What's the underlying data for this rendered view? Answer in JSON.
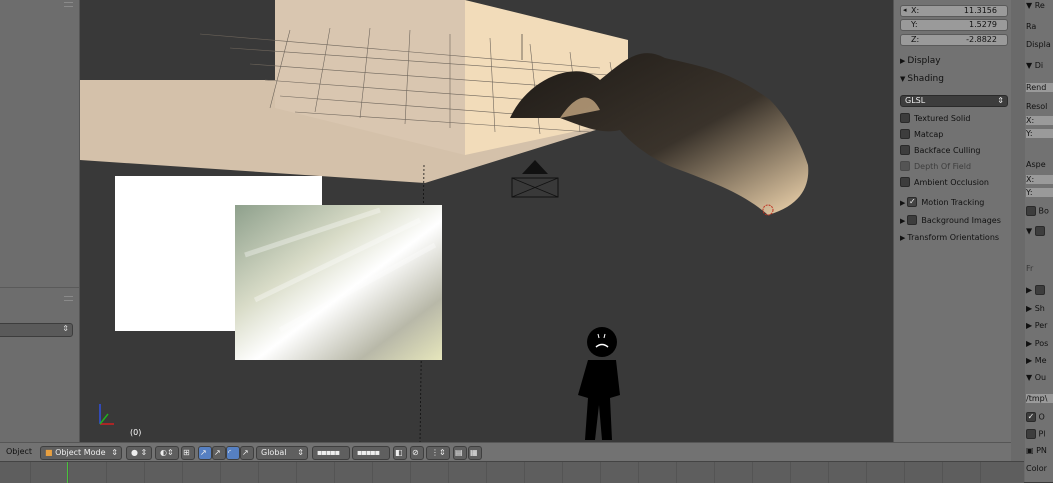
{
  "transform": {
    "x_label": "X:",
    "x_value": "11.3156",
    "y_label": "Y:",
    "y_value": "1.5279",
    "z_label": "Z:",
    "z_value": "-2.8822"
  },
  "panels": {
    "display": "Display",
    "shading": "Shading",
    "shading_mode": "GLSL",
    "textured_solid": "Textured Solid",
    "matcap": "Matcap",
    "backface_culling": "Backface Culling",
    "depth_of_field": "Depth Of Field",
    "ambient_occlusion": "Ambient Occlusion",
    "motion_tracking": "Motion Tracking",
    "background_images": "Background Images",
    "transform_orientations": "Transform Orientations"
  },
  "viewport": {
    "frame_label": "(0)"
  },
  "header": {
    "editor_menu": "Object",
    "mode": "Object Mode",
    "orientation": "Global"
  },
  "far_right": {
    "render_label": "Re",
    "render_btn": "Ra",
    "display_label": "Displa",
    "dimensions": "Di",
    "render_preset": "Rend",
    "resolution": "Resol",
    "res_x": "X:",
    "res_y": "Y:",
    "aspect": "Aspe",
    "asp_x": "X:",
    "asp_y": "Y:",
    "border": "Bo",
    "frame_rate": "Fr",
    "shape": "Sh",
    "performance": "Per",
    "post": "Pos",
    "metadata": "Me",
    "output": "Ou",
    "output_path": "/tmp\\",
    "overwrite": "O",
    "placeholders": "Pl",
    "format": "PN",
    "color": "Color"
  },
  "colors": {
    "viewport_bg": "#393939",
    "panel_bg": "#727272",
    "active_frame": "#49c33b"
  }
}
